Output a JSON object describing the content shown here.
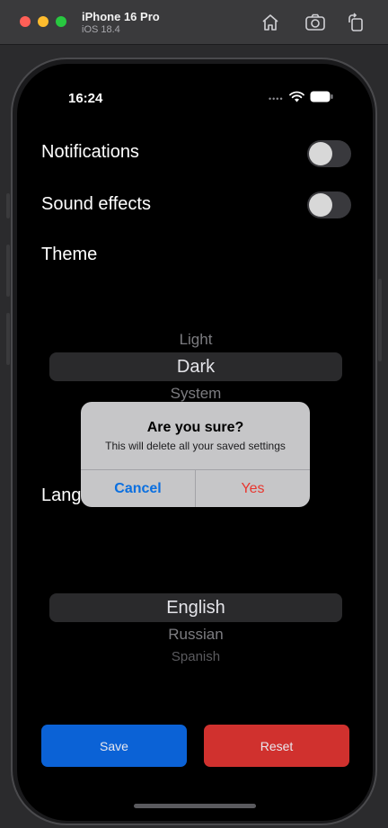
{
  "simulator": {
    "device_name": "iPhone 16 Pro",
    "os_version": "iOS 18.4",
    "icons": [
      "home-icon",
      "screenshot-icon",
      "rotate-icon"
    ]
  },
  "status_bar": {
    "time": "16:24",
    "icons": [
      "wifi-icon",
      "battery-icon"
    ]
  },
  "settings": {
    "notifications": {
      "label": "Notifications",
      "on": false
    },
    "sound_effects": {
      "label": "Sound effects",
      "on": false
    },
    "theme": {
      "label": "Theme",
      "options": [
        "Light",
        "Dark",
        "System"
      ],
      "selected": "Dark"
    },
    "language": {
      "label": "Lang",
      "options": [
        "English",
        "Russian",
        "Spanish"
      ],
      "selected": "English"
    }
  },
  "actions": {
    "save_label": "Save",
    "reset_label": "Reset"
  },
  "alert": {
    "title": "Are you sure?",
    "message": "This will delete all your saved settings",
    "cancel_label": "Cancel",
    "confirm_label": "Yes"
  },
  "colors": {
    "save": "#0b62d6",
    "reset": "#d0312e",
    "alert_cancel": "#0a6fe0",
    "alert_confirm": "#e8362f"
  }
}
